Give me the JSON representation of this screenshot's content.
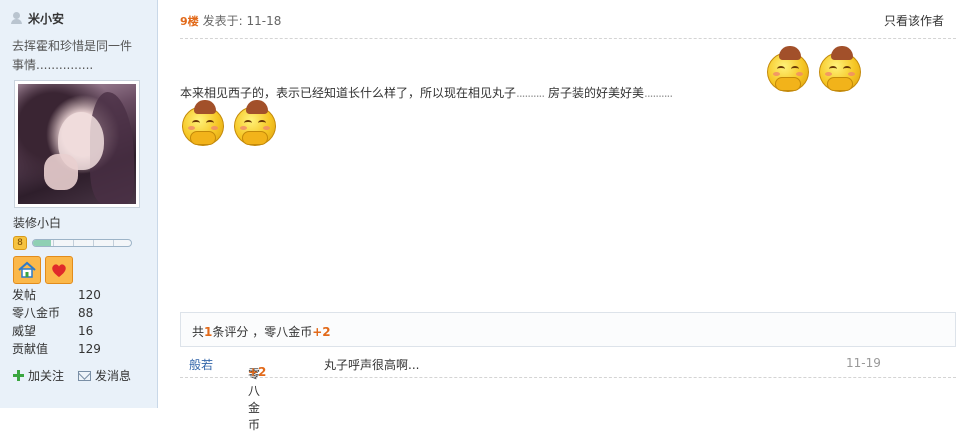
{
  "user": {
    "name": "米小安",
    "signature": "去挥霍和珍惜是同一件事情...............",
    "rank": "装修小白",
    "level_icon_label": "8",
    "level_progress": 0.18,
    "stats": [
      {
        "label": "发帖",
        "value": "120"
      },
      {
        "label": "零八金币",
        "value": "88"
      },
      {
        "label": "威望",
        "value": "16"
      },
      {
        "label": "贡献值",
        "value": "129"
      }
    ],
    "follow_label": "加关注",
    "message_label": "发消息"
  },
  "post": {
    "floor": "9楼",
    "posted_at": "发表于: 11-18",
    "only_author": "只看该作者",
    "text_a": "本来相见西子的，表示已经知道长什么样了，所以现在相见丸子",
    "ellipsis_a": "..........",
    "text_b": "房子装的好美好美",
    "ellipsis_b": ".........."
  },
  "rating": {
    "prefix": "共",
    "count": "1",
    "suffix": "条评分 ，零八金币",
    "amount": "+2",
    "entries": [
      {
        "user": "般若",
        "coin_label": "零八金币",
        "amount": "+2",
        "message": "丸子呼声很高啊...",
        "date": "11-19"
      }
    ]
  },
  "colors": {
    "accent": "#e26a1a",
    "link": "#3366aa",
    "sidebar_bg": "#e9f1f9"
  },
  "icons": [
    "user-icon",
    "level-icon",
    "home-medal-icon",
    "heart-medal-icon",
    "plus-icon",
    "envelope-icon",
    "laughing-emoticon"
  ]
}
